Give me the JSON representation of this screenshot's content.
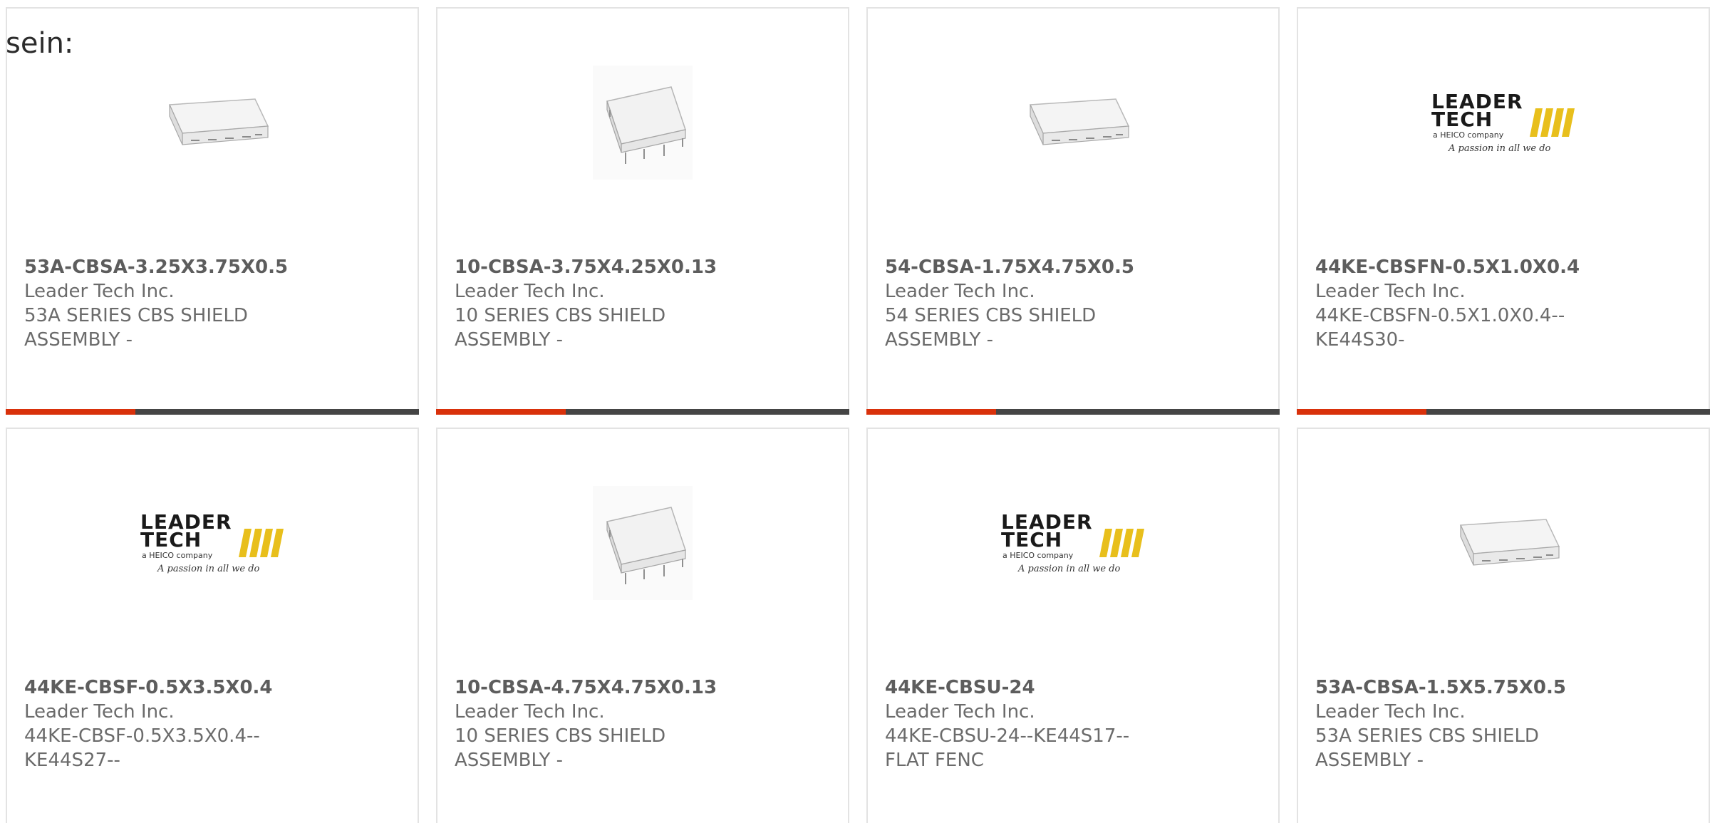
{
  "intro_label": "sein:",
  "colors": {
    "accent": "#d9310b",
    "bar_dark": "#454545",
    "text": "#6b6b6b",
    "border": "#e3e3e3",
    "logo_yellow": "#e8bf1c"
  },
  "logo": {
    "line1": "LEADER",
    "line2": "TECH",
    "tagline": "a HEICO company",
    "script": "A passion in all we do"
  },
  "products": [
    {
      "part_number": "53A-CBSA-3.25X3.75X0.5",
      "manufacturer": "Leader Tech Inc.",
      "description": "53A SERIES CBS SHIELD ASSEMBLY -",
      "image": "flat-shield-image"
    },
    {
      "part_number": "10-CBSA-3.75X4.25X0.13",
      "manufacturer": "Leader Tech Inc.",
      "description": "10 SERIES CBS SHIELD ASSEMBLY -",
      "image": "pin-shield-image"
    },
    {
      "part_number": "54-CBSA-1.75X4.75X0.5",
      "manufacturer": "Leader Tech Inc.",
      "description": "54 SERIES CBS SHIELD ASSEMBLY -",
      "image": "flat-shield-image"
    },
    {
      "part_number": "44KE-CBSFN-0.5X1.0X0.4",
      "manufacturer": "Leader Tech Inc.",
      "description": "44KE-CBSFN-0.5X1.0X0.4--KE44S30-",
      "image": "leader-tech-logo"
    },
    {
      "part_number": "44KE-CBSF-0.5X3.5X0.4",
      "manufacturer": "Leader Tech Inc.",
      "description": "44KE-CBSF-0.5X3.5X0.4--KE44S27--",
      "image": "leader-tech-logo"
    },
    {
      "part_number": "10-CBSA-4.75X4.75X0.13",
      "manufacturer": "Leader Tech Inc.",
      "description": "10 SERIES CBS SHIELD ASSEMBLY -",
      "image": "pin-shield-image"
    },
    {
      "part_number": "44KE-CBSU-24",
      "manufacturer": "Leader Tech Inc.",
      "description": "44KE-CBSU-24--KE44S17--FLAT FENC",
      "image": "leader-tech-logo"
    },
    {
      "part_number": "53A-CBSA-1.5X5.75X0.5",
      "manufacturer": "Leader Tech Inc.",
      "description": "53A SERIES CBS SHIELD ASSEMBLY -",
      "image": "flat-shield-image"
    }
  ]
}
